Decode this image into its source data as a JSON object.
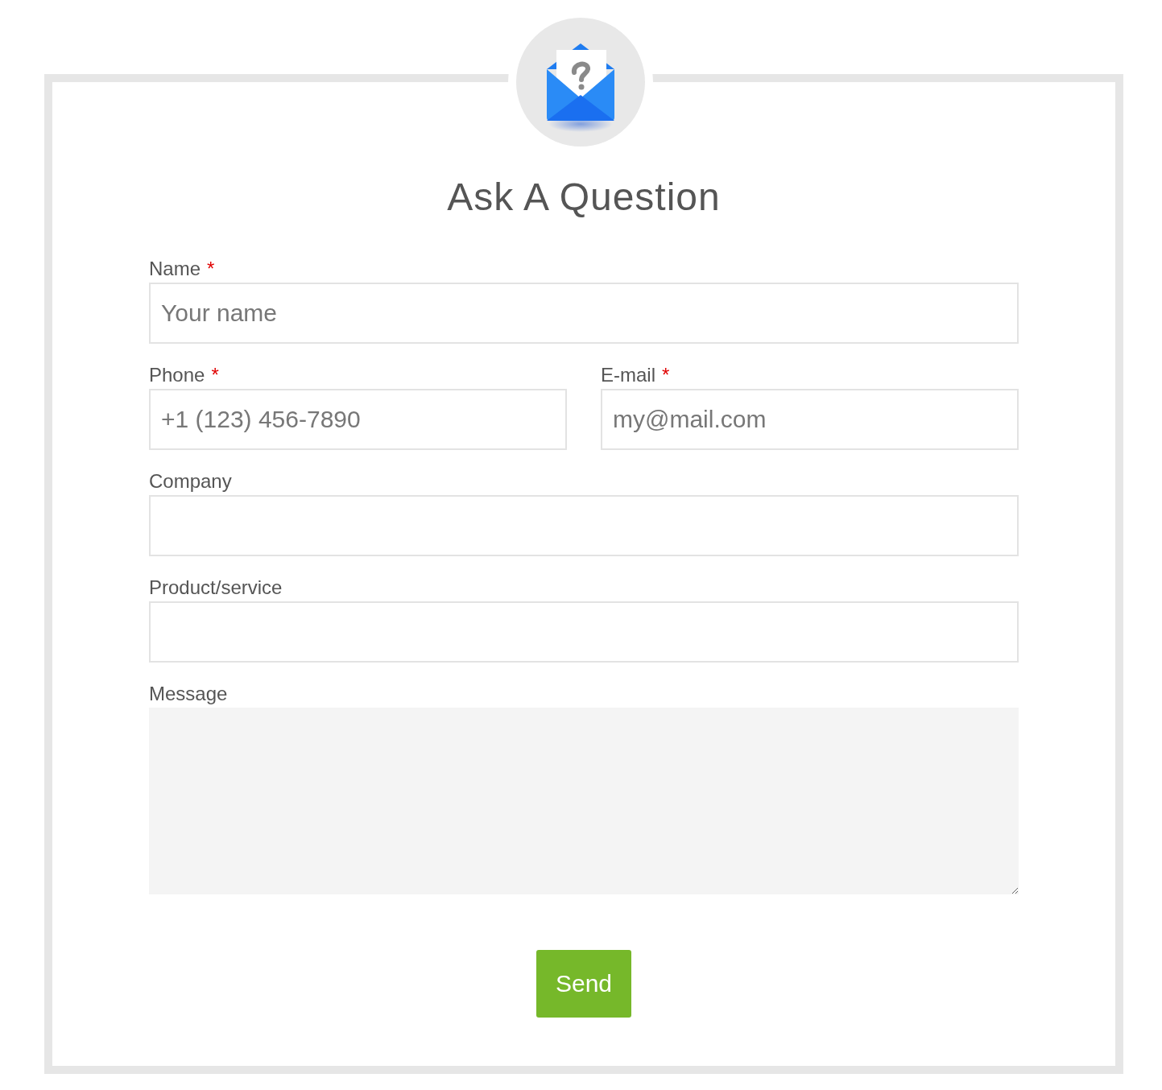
{
  "title": "Ask A Question",
  "rows": [
    [
      {
        "label": "Name",
        "required_mark": "*",
        "kind": "input",
        "placeholder": "Your name"
      }
    ],
    [
      {
        "label": "Phone",
        "required_mark": "*",
        "kind": "input",
        "placeholder": "+1 (123) 456-7890"
      },
      {
        "label": "E-mail",
        "required_mark": "*",
        "kind": "input",
        "placeholder": "my@mail.com"
      }
    ],
    [
      {
        "label": "Company",
        "kind": "input"
      }
    ],
    [
      {
        "label": "Product/service",
        "kind": "input"
      }
    ],
    [
      {
        "label": "Message",
        "kind": "textarea"
      }
    ]
  ],
  "submit": "Send"
}
